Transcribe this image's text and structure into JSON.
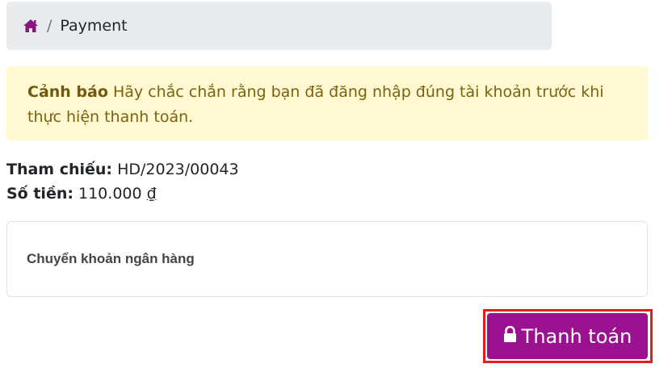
{
  "breadcrumb": {
    "home_icon": "home-icon",
    "separator": "/",
    "current": "Payment"
  },
  "alert": {
    "title": "Cảnh báo",
    "message": " Hãy chắc chắn rằng bạn đã đăng nhập đúng tài khoản trước khi thực hiện thanh toán."
  },
  "info": {
    "reference_label": "Tham chiếu:",
    "reference_value": " HD/2023/00043",
    "amount_label": "Số tiền:",
    "amount_value": " 110.000 ",
    "currency": "₫"
  },
  "payment_method": {
    "label": "Chuyển khoản ngân hàng"
  },
  "pay_button": {
    "icon": "lock-icon",
    "label": "Thanh toán"
  },
  "colors": {
    "accent": "#9b1290",
    "alert_bg": "#fff8d1",
    "highlight": "#e0201f"
  }
}
